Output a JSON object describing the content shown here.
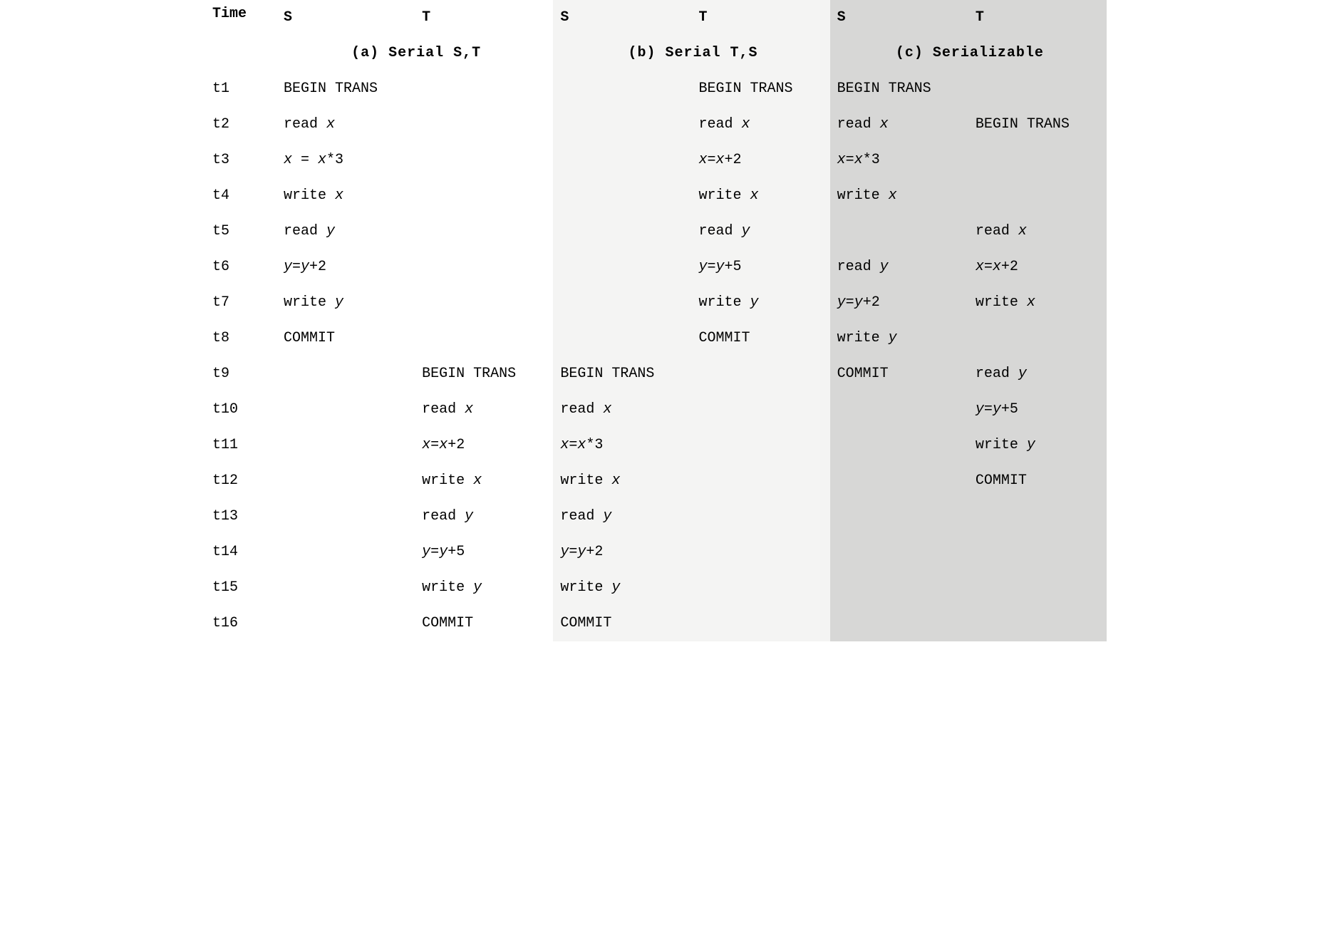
{
  "headers": {
    "time": "Time",
    "s": "S",
    "t": "T"
  },
  "captions": {
    "a": "(a) Serial S,T",
    "b": "(b) Serial T,S",
    "c": "(c) Serializable"
  },
  "time_steps": [
    "t1",
    "t2",
    "t3",
    "t4",
    "t5",
    "t6",
    "t7",
    "t8",
    "t9",
    "t10",
    "t11",
    "t12",
    "t13",
    "t14",
    "t15",
    "t16"
  ],
  "schedules": {
    "a": {
      "S": [
        "BEGIN TRANS",
        "read x",
        "x = x*3",
        "write x",
        "read y",
        "y=y+2",
        "write y",
        "COMMIT",
        "",
        "",
        "",
        "",
        "",
        "",
        "",
        ""
      ],
      "T": [
        "",
        "",
        "",
        "",
        "",
        "",
        "",
        "",
        "BEGIN TRANS",
        "read x",
        "x=x+2",
        "write x",
        "read y",
        "y=y+5",
        "write y",
        "COMMIT"
      ]
    },
    "b": {
      "S": [
        "",
        "",
        "",
        "",
        "",
        "",
        "",
        "",
        "BEGIN TRANS",
        "read x",
        "x=x*3",
        "write x",
        "read y",
        "y=y+2",
        "write y",
        "COMMIT"
      ],
      "T": [
        "BEGIN TRANS",
        "read x",
        "x=x+2",
        "write x",
        "read y",
        "y=y+5",
        "write y",
        "COMMIT",
        "",
        "",
        "",
        "",
        "",
        "",
        "",
        ""
      ]
    },
    "c": {
      "S": [
        "BEGIN TRANS",
        "read x",
        "x=x*3",
        "write x",
        "",
        "read y",
        "y=y+2",
        "write y",
        "COMMIT",
        "",
        "",
        "",
        "",
        "",
        "",
        ""
      ],
      "T": [
        "",
        "BEGIN TRANS",
        "",
        "",
        "read x",
        "x=x+2",
        "write x",
        "",
        "read y",
        "y=y+5",
        "write y",
        "COMMIT",
        "",
        "",
        "",
        ""
      ]
    }
  }
}
